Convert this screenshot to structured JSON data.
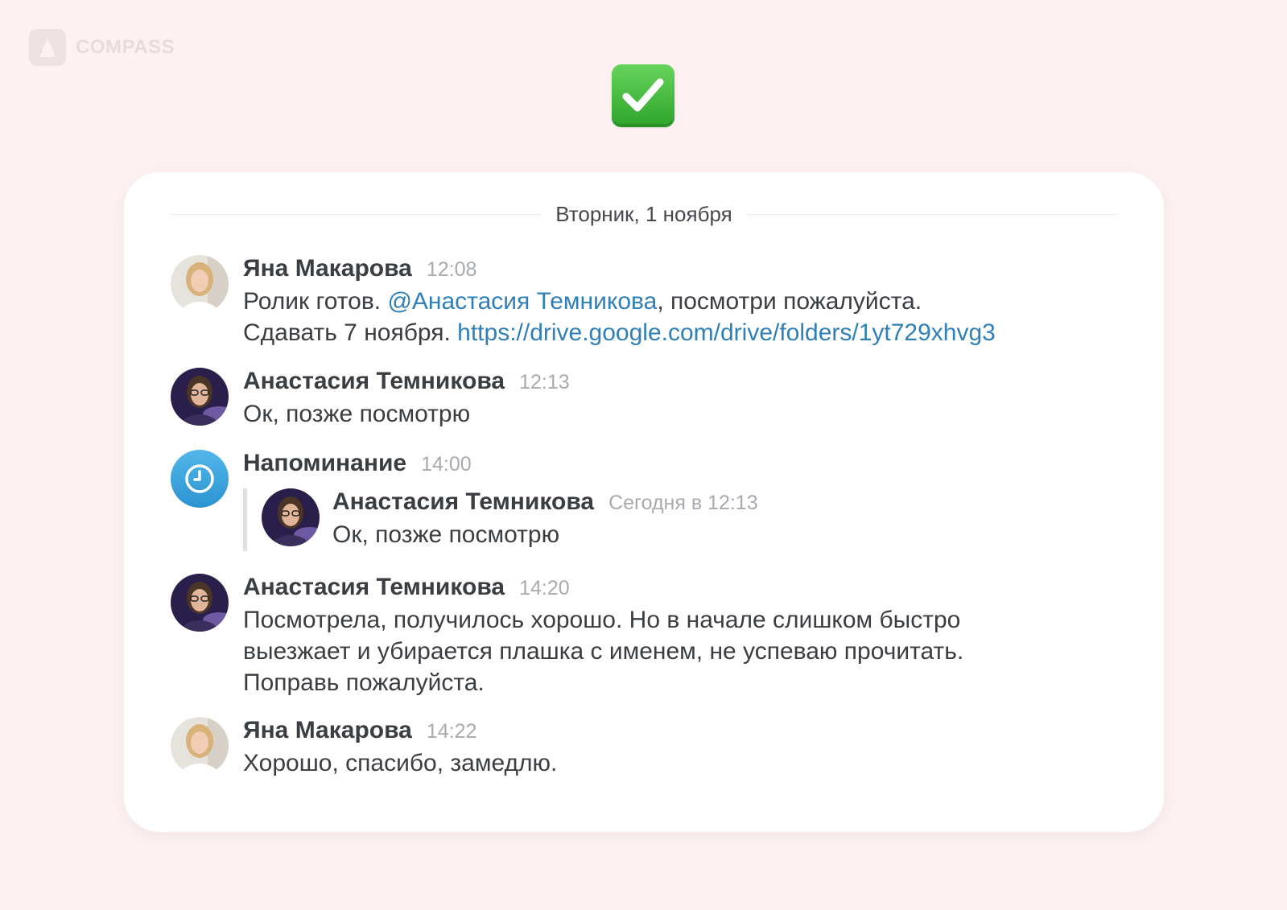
{
  "brand": {
    "name": "COMPASS"
  },
  "status_emoji": "check-mark-button",
  "chat": {
    "date": "Вторник, 1 ноября",
    "messages": [
      {
        "author": "Яна Макарова",
        "time": "12:08",
        "text_before": "Ролик готов. ",
        "mention": "@Анастасия Темникова",
        "text_after": ", посмотри пожалуйста.",
        "text_line2": "Сдавать 7 ноября. ",
        "link": "https://drive.google.com/drive/folders/1yt729xhvg3"
      },
      {
        "author": "Анастасия Темникова",
        "time": "12:13",
        "text": "Ок, позже посмотрю"
      },
      {
        "author": "Напоминание",
        "time": "14:00",
        "quote": {
          "author": "Анастасия Темникова",
          "time": "Сегодня в 12:13",
          "text": "Ок, позже посмотрю"
        }
      },
      {
        "author": "Анастасия Темникова",
        "time": "14:20",
        "text": "Посмотрела, получилось хорошо. Но в начале слишком быстро\nвыезжает и убирается плашка с именем, не успеваю прочитать.\nПоправь пожалуйста."
      },
      {
        "author": "Яна Макарова",
        "time": "14:22",
        "text": "Хорошо, спасибо, замедлю."
      }
    ]
  },
  "colors": {
    "background": "#fdf1f1",
    "link": "#2f7fb8",
    "reminder": "#3aa5e0",
    "check": "#3cb636"
  }
}
